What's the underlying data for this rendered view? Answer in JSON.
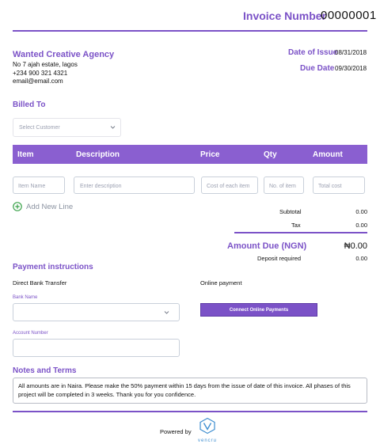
{
  "header": {
    "invoice_label": "Invoice Number",
    "invoice_number": "00000001"
  },
  "sender": {
    "name": "Wanted Creative Agency",
    "address": "No 7 ajah estate, lagos",
    "phone": "+234 900 321 4321",
    "email": "email@email.com"
  },
  "dates": {
    "issue_label": "Date of Issue",
    "issue_value": "08/31/2018",
    "due_label": "Due Date",
    "due_value": "09/30/2018"
  },
  "billed_to": {
    "title": "Billed To",
    "customer_placeholder": "Select Customer"
  },
  "table": {
    "headers": [
      "Item",
      "Description",
      "Price",
      "Qty",
      "Amount"
    ],
    "inputs": {
      "item": "Item Name",
      "description": "Enter description",
      "price": "Cost of each item",
      "qty": "No. of item",
      "total": "Total cost"
    },
    "add_line": "Add New Line"
  },
  "totals": {
    "subtotal_label": "Subtotal",
    "subtotal_value": "0.00",
    "tax_label": "Tax",
    "tax_value": "0.00",
    "amount_due_label": "Amount Due (NGN)",
    "amount_due_value": "₦0.00",
    "deposit_label": "Deposit required",
    "deposit_value": "0.00"
  },
  "payment": {
    "title": "Payment instructions",
    "bank_transfer": "Direct Bank Transfer",
    "online_payment": "Online payment",
    "bank_name_label": "Bank Name",
    "account_number_label": "Account Number",
    "connect_button": "Connect Online Payments"
  },
  "notes": {
    "title": "Notes and Terms",
    "text": "All amounts are in Naira. Please make the 50% payment within 15 days from the issue of date of this invoice. All phases of this project will be completed in 3 weeks. Thank you for you confidence."
  },
  "footer": {
    "powered_by": "Powered by",
    "brand": "vencru"
  },
  "colors": {
    "accent": "#7b52c7",
    "table_header": "#8a5fd0",
    "add_line_green": "#3aa24a"
  }
}
